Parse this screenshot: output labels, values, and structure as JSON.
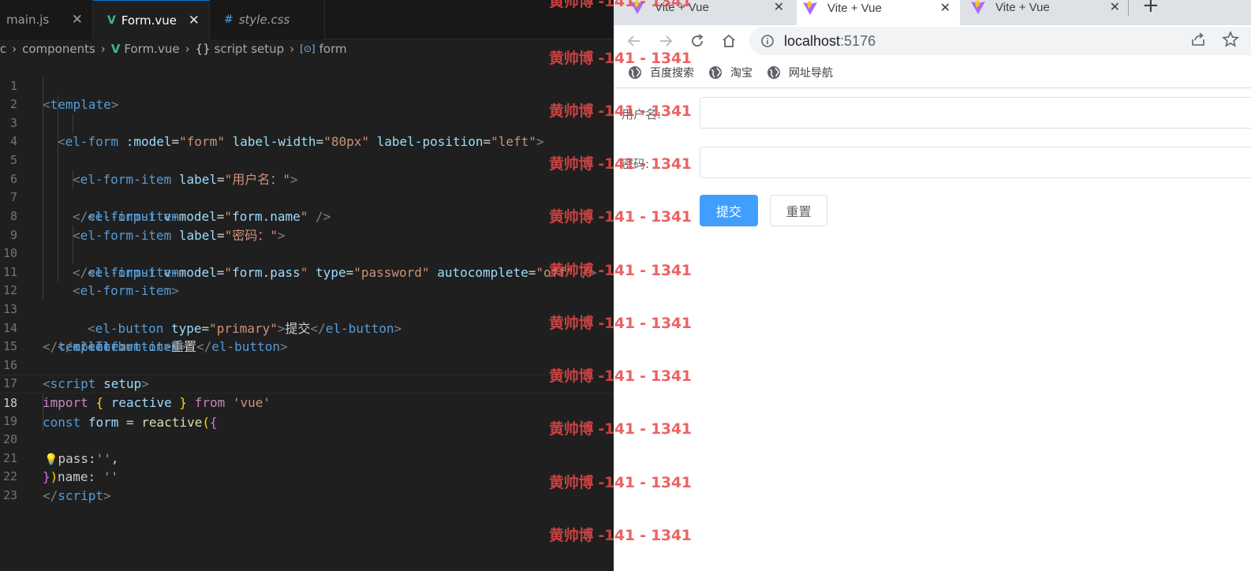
{
  "editor": {
    "tabs": [
      {
        "name": "main.js",
        "icon": "",
        "close": "✕"
      },
      {
        "name": "Form.vue",
        "icon": "V",
        "close": "✕"
      },
      {
        "name": "style.css",
        "icon": "#",
        "close": ""
      }
    ],
    "breadcrumb": {
      "root": "rc",
      "folder": "components",
      "file": "Form.vue",
      "section_icon": "{}",
      "section": "script setup",
      "symbol_icon": "[⊙]",
      "symbol": "form"
    },
    "current_line": 18,
    "lines": [
      {
        "n": "1"
      },
      {
        "n": "2"
      },
      {
        "n": "3"
      },
      {
        "n": "4"
      },
      {
        "n": "5"
      },
      {
        "n": "6"
      },
      {
        "n": "7"
      },
      {
        "n": "8"
      },
      {
        "n": "9"
      },
      {
        "n": "10"
      },
      {
        "n": "11"
      },
      {
        "n": "12"
      },
      {
        "n": "13"
      },
      {
        "n": "14"
      },
      {
        "n": "15"
      },
      {
        "n": "16"
      },
      {
        "n": "17"
      },
      {
        "n": "18"
      },
      {
        "n": "19"
      },
      {
        "n": "20"
      },
      {
        "n": "21"
      },
      {
        "n": "22"
      },
      {
        "n": "23"
      }
    ],
    "code": {
      "l1": {
        "open": "<",
        "tag": "template",
        "close": ">"
      },
      "l2": {
        "open": "<",
        "tag": "el-form",
        "a1": ":model",
        "eq1": "=",
        "v1": "\"form\"",
        "a2": "label-width",
        "eq2": "=",
        "v2": "\"80px\"",
        "a3": "label-position",
        "eq3": "=",
        "v3": "\"left\"",
        "close": ">"
      },
      "l3": {
        "open": "<",
        "tag": "el-form-item",
        "a1": "label",
        "eq1": "=",
        "v1": "\"用户名：\"",
        "close": ">"
      },
      "l4": {
        "open": "<",
        "tag": "el-input",
        "a1": "v-model",
        "eq1": "=",
        "v1q1": "\"",
        "v1": "form.name",
        "v1q2": "\"",
        "close": "/>"
      },
      "l5": {
        "open": "</",
        "tag": "el-form-item",
        "close": ">"
      },
      "l6": {
        "open": "<",
        "tag": "el-form-item",
        "a1": "label",
        "eq1": "=",
        "v1": "\"密码：\"",
        "close": ">"
      },
      "l7": {
        "open": "<",
        "tag": "el-input",
        "a1": "v-model",
        "eq1": "=",
        "v1q1": "\"",
        "v1": "form.pass",
        "v1q2": "\"",
        "a2": "type",
        "eq2": "=",
        "v2": "\"password\"",
        "a3": "autocomplete",
        "eq3": "=",
        "v3": "\"off\"",
        "close": "/>"
      },
      "l8": {
        "open": "</",
        "tag": "el-form-item",
        "close": ">"
      },
      "l9": {
        "open": "<",
        "tag": "el-form-item",
        "close": ">"
      },
      "l10": {
        "open": "<",
        "tag": "el-button",
        "a1": "type",
        "eq1": "=",
        "v1": "\"primary\"",
        "close": ">",
        "text": "提交",
        "open2": "</",
        "tag2": "el-button",
        "close2": ">"
      },
      "l11": {
        "open": "<",
        "tag": "el-button",
        "close": ">",
        "text": "重置",
        "open2": "</",
        "tag2": "el-button",
        "close2": ">"
      },
      "l12": {
        "open": "</",
        "tag": "el-form-item",
        "close": ">"
      },
      "l13": {
        "open": "</",
        "tag": "el-form",
        "close": ">"
      },
      "l14": {
        "open": "</",
        "tag": "template",
        "close": ">"
      },
      "l16": {
        "open": "<",
        "tag": "script",
        "a1": "setup",
        "close": ">"
      },
      "l17": {
        "kw": "import",
        "b1": "{",
        "id": "reactive",
        "b2": "}",
        "kw2": "from",
        "str": "'vue'"
      },
      "l18": {
        "decl": "const",
        "id": "form",
        "eq": "=",
        "fn": "reactive",
        "p1": "(",
        "b1": "{"
      },
      "l19": {
        "bulb": "💡",
        "prop": "pass",
        "colon": ":",
        "str": "''",
        "comma": ","
      },
      "l20": {
        "prop": "name",
        "colon": ":",
        "str": "''"
      },
      "l21": {
        "b1": "}",
        "p1": ")"
      },
      "l22": {
        "open": "</",
        "tag": "script",
        "close": ">"
      }
    }
  },
  "browser": {
    "tabs": [
      {
        "title": "Vite + Vue",
        "close": "✕"
      },
      {
        "title": "Vite + Vue",
        "close": "✕"
      },
      {
        "title": "Vite + Vue",
        "close": "✕"
      }
    ],
    "new_tab": "+",
    "url_host": "localhost",
    "url_port": ":5176",
    "bookmarks": [
      "百度搜索",
      "淘宝",
      "网址导航"
    ],
    "form": {
      "name_label": "用户名:",
      "pass_label": "密码:",
      "name_value": "",
      "pass_value": "",
      "submit_label": "提交",
      "reset_label": "重置"
    },
    "accent": "#409eff"
  },
  "watermark": {
    "text": "黄帅博 -141 - 1341",
    "top_text": "黄帅博 -141 - 1341"
  }
}
